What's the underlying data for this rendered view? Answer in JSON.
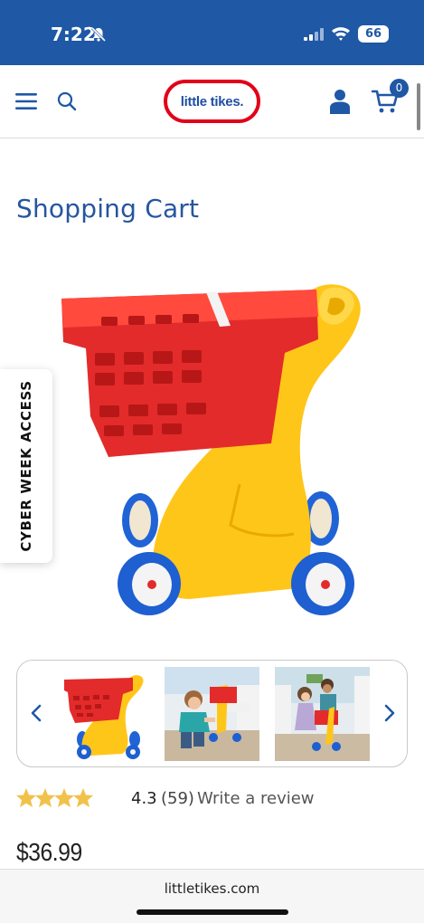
{
  "status_bar": {
    "time": "7:22",
    "battery": "66",
    "bg_color": "#1f58a5"
  },
  "header": {
    "menu_icon": "menu-icon",
    "search_icon": "search-icon",
    "logo_text": "little tikes.",
    "account_icon": "account-icon",
    "cart_icon": "cart-icon",
    "cart_count": "0"
  },
  "product": {
    "title": "Shopping Cart",
    "rating_value": "4.3",
    "rating_count": "(59)",
    "rating": 4.3,
    "review_link": "Write a review",
    "price": "$36.99"
  },
  "side_tab": {
    "label": "CYBER WEEK ACCESS"
  },
  "gallery": {
    "prev_icon": "chevron-left-icon",
    "next_icon": "chevron-right-icon"
  },
  "browser": {
    "url": "littletikes.com"
  },
  "colors": {
    "brand_blue": "#1f58a5",
    "title_blue": "#2556a0",
    "logo_red": "#e2001a",
    "star_gold": "#f1c24b",
    "cart_red": "#e32b2b",
    "cart_yellow": "#ffc61a",
    "wheel_blue": "#1e5fd1"
  }
}
